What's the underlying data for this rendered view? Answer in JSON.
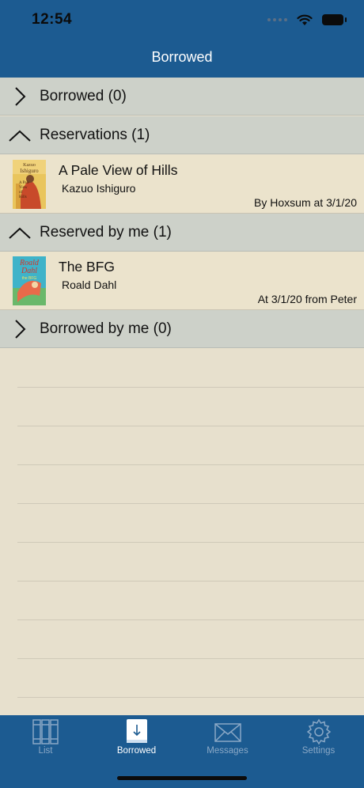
{
  "status_bar": {
    "time": "12:54"
  },
  "nav": {
    "title": "Borrowed"
  },
  "sections": [
    {
      "label": "Borrowed (0)",
      "state": "collapsed"
    },
    {
      "label": "Reservations (1)",
      "state": "expanded"
    },
    {
      "label": "Reserved by me (1)",
      "state": "expanded"
    },
    {
      "label": "Borrowed by me (0)",
      "state": "collapsed"
    }
  ],
  "reservations": [
    {
      "title": "A Pale View of Hills",
      "author": "Kazuo Ishiguro",
      "meta": "By Hoxsum at 3/1/20",
      "cover_text": [
        "Kazuo",
        "Ishiguro",
        "A Pale",
        "View",
        "of",
        "Hills"
      ]
    }
  ],
  "reserved_by_me": [
    {
      "title": "The BFG",
      "author": "Roald Dahl",
      "meta": "At 3/1/20 from Peter",
      "cover_text": [
        "Roald",
        "Dahl",
        "the BFG"
      ]
    }
  ],
  "tabs": [
    {
      "label": "List",
      "icon": "books-icon",
      "active": false
    },
    {
      "label": "Borrowed",
      "icon": "borrowed-book-icon",
      "active": true
    },
    {
      "label": "Messages",
      "icon": "envelope-icon",
      "active": false
    },
    {
      "label": "Settings",
      "icon": "gear-icon",
      "active": false
    }
  ],
  "colors": {
    "bar": "#1c5b91",
    "section_header": "#cdd1c9",
    "row_background": "#ebe3cc",
    "page_background": "#e7e0cd",
    "tab_inactive": "#8aa8c6",
    "tab_active": "#ffffff"
  }
}
